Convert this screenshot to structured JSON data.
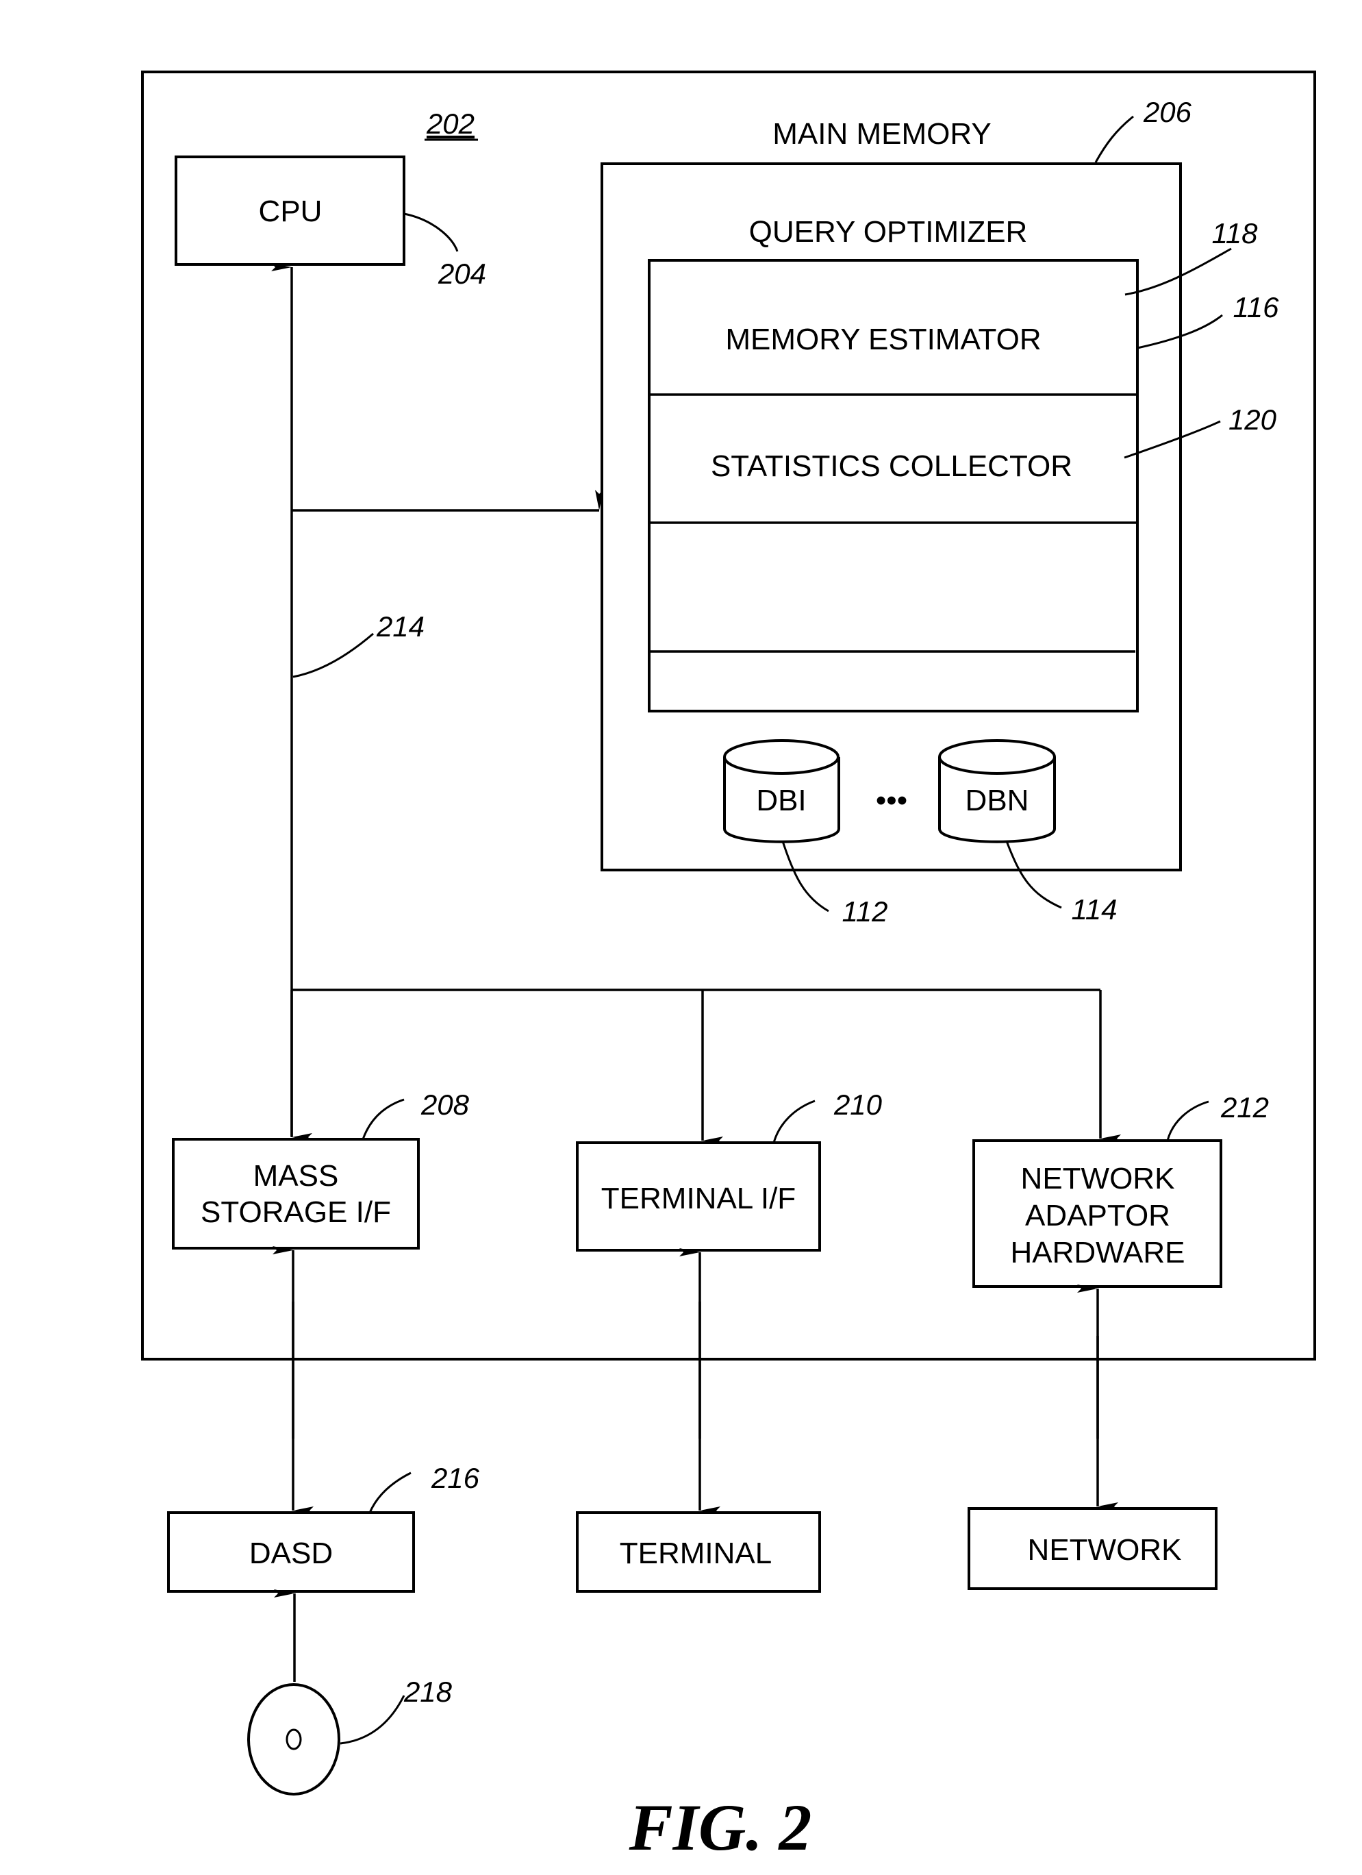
{
  "figure": {
    "caption": "FIG. 2",
    "system_ref": "202",
    "cpu": {
      "label": "CPU",
      "ref": "204"
    },
    "main_memory": {
      "label": "MAIN MEMORY",
      "ref": "206",
      "query_optimizer": {
        "label": "QUERY OPTIMIZER",
        "ref": "116",
        "memory_estimator": {
          "label": "MEMORY ESTIMATOR",
          "ref": "118"
        },
        "statistics_collector": {
          "label": "STATISTICS COLLECTOR",
          "ref": "120"
        }
      },
      "databases": [
        {
          "label": "DBI",
          "ref": "112"
        },
        {
          "label": "DBN",
          "ref": "114"
        }
      ],
      "ellipsis": "•••"
    },
    "bus": {
      "ref": "214"
    },
    "interfaces": {
      "mass_storage": {
        "lines": [
          "MASS",
          "STORAGE I/F"
        ],
        "ref": "208"
      },
      "terminal_if": {
        "label": "TERMINAL I/F",
        "ref": "210"
      },
      "network_adaptor": {
        "lines": [
          "NETWORK",
          "ADAPTOR",
          "HARDWARE"
        ],
        "ref": "212"
      }
    },
    "external": {
      "dasd": {
        "label": "DASD",
        "ref": "216"
      },
      "terminal": {
        "label": "TERMINAL"
      },
      "network": {
        "label": "NETWORK"
      },
      "disc": {
        "ref": "218"
      }
    }
  }
}
